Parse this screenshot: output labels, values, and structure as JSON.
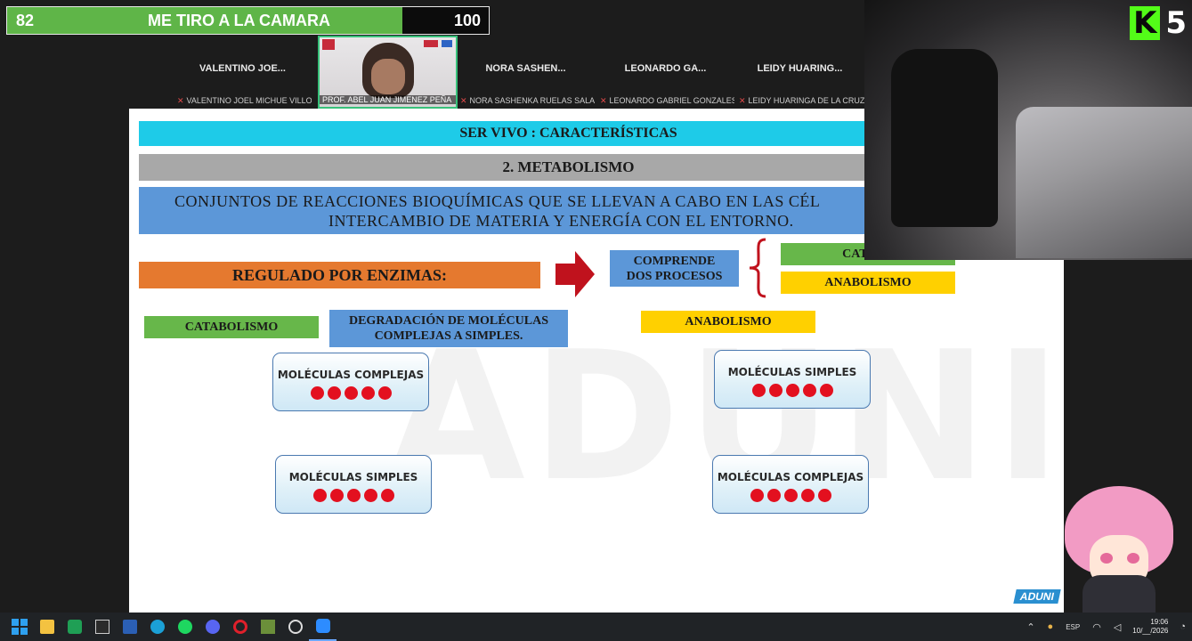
{
  "goal_bar": {
    "current": "82",
    "title": "ME TIRO A LA CAMARA",
    "max": "100",
    "progress_fraction": 0.82,
    "fill_color": "#5fb548"
  },
  "participants": [
    {
      "name": "VALENTINO JOE...",
      "full": "VALENTINO JOEL MICHUE VILLO...",
      "muted": true
    },
    {
      "name": "",
      "full": "PROF. ABEL JUAN JIMENEZ PEÑA",
      "video": true
    },
    {
      "name": "NORA SASHEN...",
      "full": "NORA SASHENKA RUELAS SALA...",
      "muted": true
    },
    {
      "name": "LEONARDO GA...",
      "full": "LEONARDO GABRIEL GONZALES...",
      "muted": true
    },
    {
      "name": "LEIDY HUARING...",
      "full": "LEIDY HUARINGA DE LA CRUZ",
      "muted": true
    }
  ],
  "slide": {
    "title": "SER VIVO : CARACTERÍSTICAS",
    "section": "2. METABOLISMO",
    "definition_line1": "CONJUNTOS DE REACCIONES BIOQUÍMICAS QUE SE LLEVAN A CABO EN LAS CÉL",
    "definition_line2": "INTERCAMBIO DE MATERIA Y ENERGÍA CON EL ENTORNO.",
    "regulated": "REGULADO POR ENZIMAS:",
    "comprises_line1": "COMPRENDE",
    "comprises_line2": "DOS PROCESOS",
    "process_catabolism_clipped": "CATABO",
    "process_anabolism": "ANABOLISMO",
    "catabolism_label": "CATABOLISMO",
    "degradation_line1": "DEGRADACIÓN DE MOLÉCULAS",
    "degradation_line2": "COMPLEJAS A SIMPLES.",
    "anabolism_label": "ANABOLISMO",
    "cat_top": "MOLÉCULAS COMPLEJAS",
    "ana_top": "MOLÉCULAS SIMPLES",
    "cat_bottom": "MOLÉCULAS SIMPLES",
    "ana_bottom": "MOLÉCULAS COMPLEJAS",
    "watermark": "ADUNI",
    "brand": "ADUNI"
  },
  "stream_badge": {
    "letter": "K",
    "count": "5"
  },
  "taskbar": {
    "apps": [
      "start-icon",
      "file-explorer-icon",
      "sheets-icon",
      "epic-games-icon",
      "word-icon",
      "edge-icon",
      "spotify-icon",
      "discord-icon",
      "opera-icon",
      "minecraft-icon",
      "obs-icon",
      "zoom-icon"
    ],
    "language": "ESP",
    "time": "19:06",
    "date": "10/__/2026"
  },
  "colors": {
    "title_band": "#1ecbe8",
    "gray_band": "#a8a8a8",
    "blue_band": "#5c97d8",
    "orange_band": "#e5792f",
    "green_band": "#67b74a",
    "yellow_band": "#ffd000",
    "dot_red": "#e3101f"
  }
}
